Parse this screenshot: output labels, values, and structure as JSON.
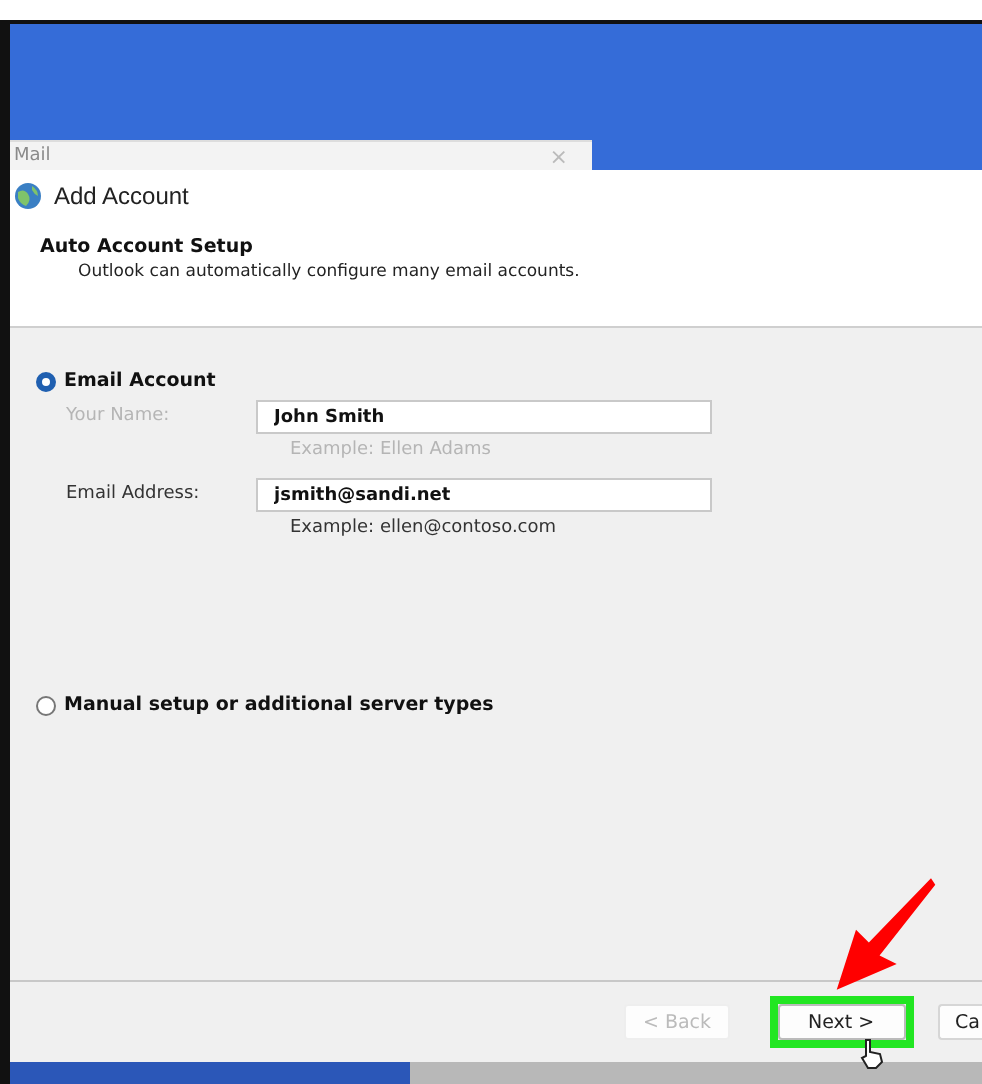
{
  "background_window": {
    "tab_title": "Mail",
    "close_glyph": "×"
  },
  "dialog": {
    "title": "Add Account",
    "header": {
      "heading": "Auto Account Setup",
      "subtitle": "Outlook can automatically configure many email accounts."
    },
    "options": [
      {
        "label": "Email Account",
        "selected": true,
        "kind": "form"
      },
      {
        "label": "Manual setup or additional server types",
        "selected": false,
        "kind": "plain"
      }
    ],
    "fields": [
      {
        "label": "Your Name:",
        "value": "John Smith",
        "example": "Example: Ellen Adams",
        "dimmed": true
      },
      {
        "label": "Email Address:",
        "value": "jsmith@sandi.net",
        "example": "Example: ellen@contoso.com",
        "dimmed": false
      }
    ],
    "buttons": [
      {
        "label": "< Back",
        "disabled": true,
        "highlighted": false
      },
      {
        "label": "Next >",
        "disabled": false,
        "highlighted": true
      },
      {
        "label": "Ca",
        "disabled": false,
        "highlighted": false
      }
    ]
  },
  "annotation": {
    "arrow": true,
    "cursor": true
  }
}
